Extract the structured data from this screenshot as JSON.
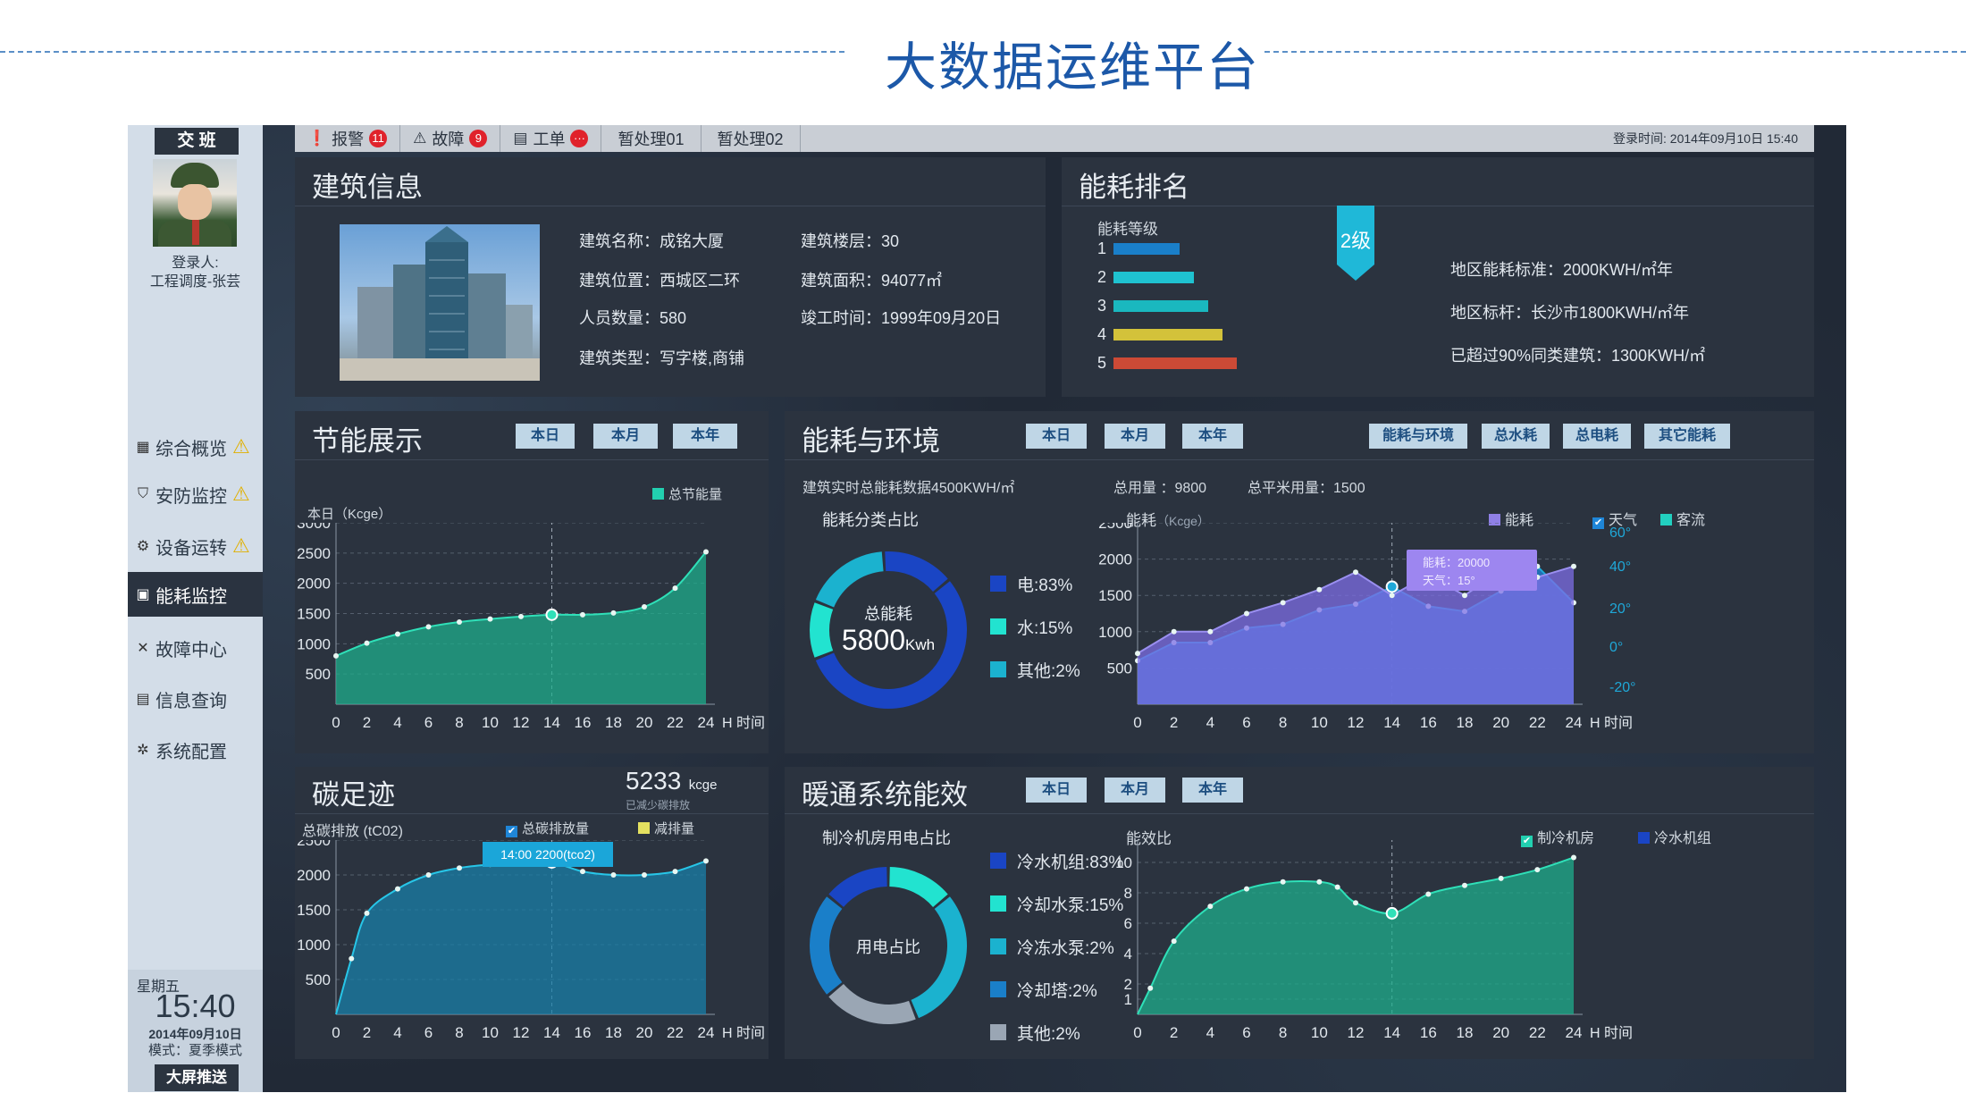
{
  "page": {
    "title": "大数据运维平台"
  },
  "sidebar": {
    "shift_label": "交 班",
    "login_label": "登录人:",
    "login_user": "工程调度-张芸",
    "items": [
      {
        "label": "综合概览",
        "icon": "chart-icon",
        "warning": true
      },
      {
        "label": "安防监控",
        "icon": "shield-icon",
        "warning": true
      },
      {
        "label": "设备运转",
        "icon": "gear-icon",
        "warning": true
      },
      {
        "label": "能耗监控",
        "icon": "monitor-icon",
        "warning": false,
        "active": true
      },
      {
        "label": "故障中心",
        "icon": "wrench-icon",
        "warning": false
      },
      {
        "label": "信息查询",
        "icon": "list-icon",
        "warning": false
      },
      {
        "label": "系统配置",
        "icon": "settings-icon",
        "warning": false
      }
    ],
    "weekday": "星期五",
    "clock": "15:40",
    "date": "2014年09月10日",
    "mode": "模式：夏季模式",
    "push_button": "大屏推送"
  },
  "topbar": {
    "alarm": {
      "label": "报警",
      "count": "11"
    },
    "fault": {
      "label": "故障",
      "count": "9"
    },
    "workorder": {
      "label": "工单",
      "count": "···"
    },
    "tab1": "暂处理01",
    "tab2": "暂处理02",
    "login_time": "登录时间: 2014年09月10日 15:40"
  },
  "building": {
    "title": "建筑信息",
    "fields": [
      "建筑名称：成铭大厦",
      "建筑楼层：30",
      "建筑位置：西城区二环",
      "建筑面积：94077㎡",
      "人员数量：580",
      "竣工时间：1999年09月20日",
      "建筑类型：写字楼,商铺"
    ]
  },
  "ranking": {
    "title": "能耗排名",
    "grade_label": "能耗等级",
    "badge": "2级",
    "levels": [
      "1",
      "2",
      "3",
      "4",
      "5"
    ],
    "level_values": [
      1,
      2,
      3,
      4,
      5
    ],
    "level_colors": [
      "#1a7fc9",
      "#1fc2d0",
      "#1ab8bf",
      "#d3c23a",
      "#cc4a36"
    ],
    "stats": [
      "地区能耗标准：2000KWH/㎡年",
      "地区标杆：长沙市1800KWH/㎡年",
      "已超过90%同类建筑：1300KWH/㎡"
    ]
  },
  "tabs_period": [
    "本日",
    "本月",
    "本年"
  ],
  "energy_saving": {
    "title": "节能展示",
    "legend": "总节能量",
    "unit_label": "本日（Kcge）",
    "x_axis_label": "H 时间",
    "chart_data": {
      "type": "area",
      "x": [
        0,
        2,
        4,
        6,
        8,
        10,
        12,
        14,
        16,
        18,
        20,
        22,
        24
      ],
      "series": [
        {
          "name": "总节能量",
          "values": [
            800,
            1010,
            1160,
            1280,
            1360,
            1410,
            1450,
            1480,
            1480,
            1510,
            1610,
            1920,
            2520
          ]
        }
      ],
      "ylim": [
        0,
        3000
      ],
      "yticks": [
        3000,
        2500,
        2000,
        1500,
        1000,
        500
      ],
      "xticks": [
        0,
        2,
        4,
        6,
        8,
        10,
        12,
        14,
        16,
        18,
        20,
        22,
        24
      ],
      "highlight_x": 14
    }
  },
  "energy_env": {
    "title": "能耗与环境",
    "extra_tabs": [
      "能耗与环境",
      "总水耗",
      "总电耗",
      "其它能耗"
    ],
    "realtime": "建筑实时总能耗数据4500KWH/㎡",
    "total_use": "总用量 ：9800",
    "total_sqm": "总平米用量：1500",
    "category_title": "能耗分类占比",
    "donut_center_label": "总能耗",
    "donut_center_value": "5800",
    "donut_center_unit": "Kwh",
    "categories": [
      {
        "label": "电:83%",
        "color": "#1a45c4",
        "value": 83
      },
      {
        "label": "水:15%",
        "color": "#22e3d0",
        "value": 15
      },
      {
        "label": "其他:2%",
        "color": "#1bb2cf",
        "value": 2
      }
    ],
    "line_title": "能耗",
    "line_unit": "（Kcge）",
    "legend": [
      "能耗",
      "天气",
      "客流"
    ],
    "tooltip": [
      "能耗：20000",
      "天气：15°"
    ],
    "x_axis_label": "H 时间",
    "chart_data": {
      "type": "area",
      "x": [
        0,
        2,
        4,
        6,
        8,
        10,
        12,
        14,
        16,
        18,
        20,
        22,
        24
      ],
      "series": [
        {
          "name": "能耗",
          "values": [
            700,
            1000,
            1000,
            1250,
            1400,
            1580,
            1820,
            1500,
            1780,
            1500,
            1850,
            1750,
            1900
          ]
        },
        {
          "name": "天气",
          "values": [
            20,
            25,
            25,
            28,
            28,
            30,
            32,
            32,
            30,
            28,
            32,
            35,
            38
          ]
        },
        {
          "name": "客流",
          "values": [
            600,
            850,
            850,
            1050,
            1100,
            1300,
            1380,
            1620,
            1350,
            1280,
            1560,
            1900,
            1400
          ]
        }
      ],
      "ylim": [
        0,
        2500
      ],
      "yticks": [
        2500,
        2000,
        1500,
        1000,
        500
      ],
      "y2ticks": [
        "60°",
        "40°",
        "20°",
        "0°",
        "-20°"
      ],
      "xticks": [
        0,
        2,
        4,
        6,
        8,
        10,
        12,
        14,
        16,
        18,
        20,
        22,
        24
      ],
      "highlight_x": 14
    }
  },
  "carbon": {
    "title": "碳足迹",
    "value": "5233",
    "unit": "kcge",
    "sub": "已减少碳排放",
    "axis_title": "总碳排放 (tC02)",
    "legend": [
      "总碳排放量",
      "减排量"
    ],
    "tooltip": "14:00  2200(tco2)",
    "x_axis_label": "H 时间",
    "chart_data": {
      "type": "area",
      "x": [
        0,
        1,
        2,
        4,
        6,
        8,
        10,
        12,
        14,
        16,
        18,
        20,
        22,
        24
      ],
      "series": [
        {
          "name": "总碳排放量",
          "values": [
            0,
            800,
            1450,
            1800,
            2000,
            2100,
            2150,
            2180,
            2180,
            2050,
            2000,
            2000,
            2050,
            2200
          ]
        }
      ],
      "ylim": [
        0,
        2500
      ],
      "yticks": [
        2500,
        2000,
        1500,
        1000,
        500
      ],
      "xticks": [
        0,
        2,
        4,
        6,
        8,
        10,
        12,
        14,
        16,
        18,
        20,
        22,
        24
      ],
      "highlight_x": 14
    }
  },
  "hvac": {
    "title": "暖通系统能效",
    "pie_title": "制冷机房用电占比",
    "donut_center_label": "用电占比",
    "categories": [
      {
        "label": "冷水机组:83%",
        "color": "#1a45c4",
        "value": 83
      },
      {
        "label": "冷却水泵:15%",
        "color": "#22e3d0",
        "value": 15
      },
      {
        "label": "冷冻水泵:2%",
        "color": "#1bb2cf",
        "value": 2
      },
      {
        "label": "冷却塔:2%",
        "color": "#1a7fc9",
        "value": 2
      },
      {
        "label": "其他:2%",
        "color": "#9aa6b4",
        "value": 2
      }
    ],
    "ratio_title": "能效比",
    "legend": [
      "制冷机房",
      "冷水机组"
    ],
    "x_axis_label": "H 时间",
    "chart_data": {
      "type": "area",
      "x": [
        0,
        0.7,
        2,
        4,
        6,
        8,
        10,
        11,
        12,
        14,
        16,
        18,
        20,
        22,
        24
      ],
      "series": [
        {
          "name": "制冷机房",
          "values": [
            0,
            1.5,
            4.2,
            6.2,
            7.2,
            7.6,
            7.6,
            7.3,
            6.4,
            5.8,
            6.9,
            7.4,
            7.8,
            8.3,
            9.0
          ]
        }
      ],
      "ylim": [
        0,
        10
      ],
      "yticks": [
        10,
        8,
        6,
        4,
        2,
        1
      ],
      "xticks": [
        0,
        2,
        4,
        6,
        8,
        10,
        12,
        14,
        16,
        18,
        20,
        22,
        24
      ],
      "highlight_x": 14
    }
  }
}
